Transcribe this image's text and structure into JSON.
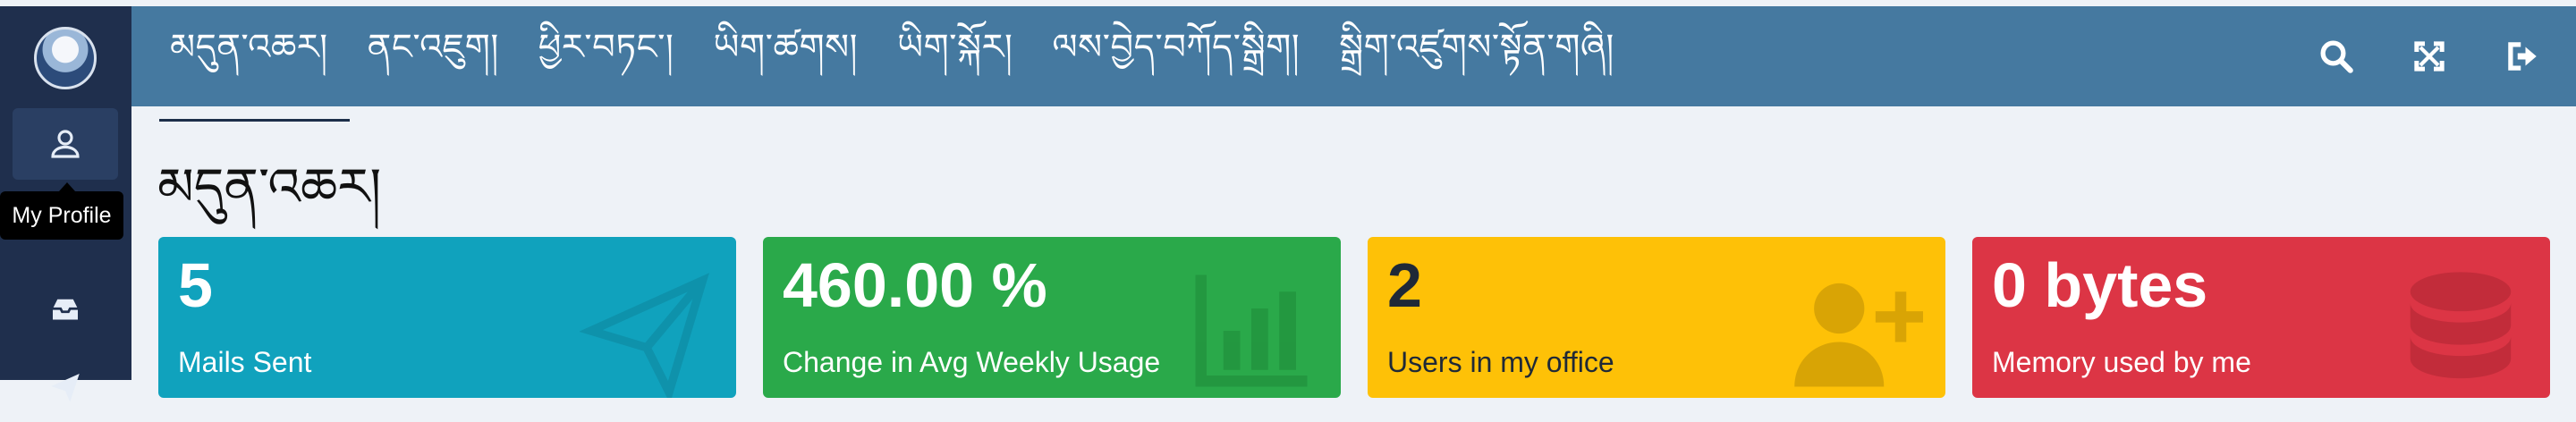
{
  "nav": {
    "items": [
      {
        "label": "མདུན་འཆར།"
      },
      {
        "label": "ནང་འཇུག།"
      },
      {
        "label": "ཕྱིར་བཏང་།"
      },
      {
        "label": "ཡིག་ཚགས།"
      },
      {
        "label": "ཡིག་སྐོར།"
      },
      {
        "label": "ལས་བྱེད་བཀོད་སྒྲིག།"
      },
      {
        "label": "སྒྲིག་འཛུགས་སྟོན་གཞི།"
      }
    ],
    "icons": [
      "search-icon",
      "expand-icon",
      "sign-out-icon"
    ]
  },
  "sidebar": {
    "tooltip": "My Profile",
    "items": [
      "user-icon",
      "inbox-icon",
      "send-icon"
    ]
  },
  "page": {
    "title": "མདུན་འཆར།"
  },
  "cards": [
    {
      "value": "5",
      "label": "Mails Sent",
      "color": "#10a2bd",
      "icon": "paper-plane-icon"
    },
    {
      "value": "460.00 %",
      "label": "Change in Avg Weekly Usage",
      "color": "#2aa94a",
      "icon": "bar-chart-icon"
    },
    {
      "value": "2",
      "label": "Users in my office",
      "color": "#fec107",
      "icon": "user-plus-icon"
    },
    {
      "value": "0 bytes",
      "label": "Memory used by me",
      "color": "#dc3545",
      "icon": "database-icon"
    }
  ]
}
